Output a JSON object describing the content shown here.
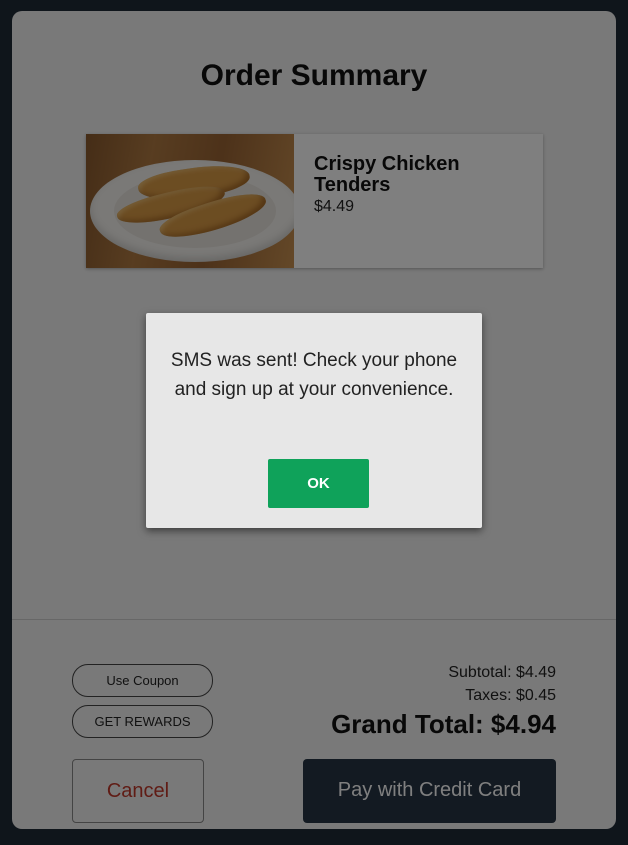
{
  "title": "Order Summary",
  "item": {
    "name": "Crispy Chicken Tenders",
    "price": "$4.49",
    "image": "chicken-tenders-photo"
  },
  "actions": {
    "coupon": "Use Coupon",
    "rewards": "GET REWARDS"
  },
  "totals": {
    "subtotal": "Subtotal: $4.49",
    "taxes": "Taxes: $0.45",
    "grand_total": "Grand Total: $4.94"
  },
  "buttons": {
    "cancel": "Cancel",
    "pay": "Pay with Credit Card"
  },
  "dialog": {
    "message": "SMS was sent! Check your phone and sign up at your convenience.",
    "ok": "OK"
  },
  "colors": {
    "background": "#1f2a36",
    "pay_button": "#263545",
    "ok_button": "#0fa25a",
    "cancel_text": "#c0392b"
  }
}
